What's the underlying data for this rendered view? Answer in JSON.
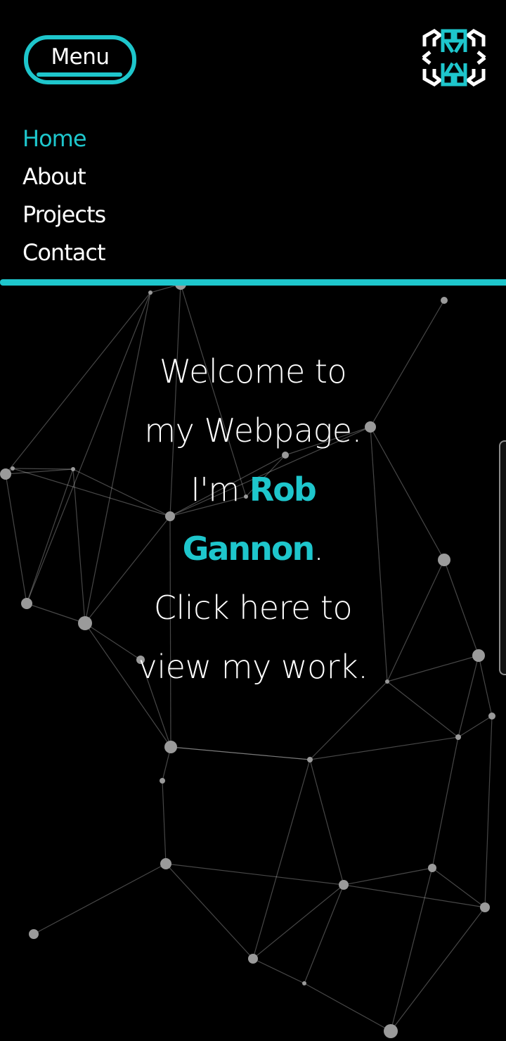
{
  "header": {
    "menu_label": "Menu",
    "logo_icon": "rr-monogram-logo-icon",
    "accent_color": "#1ec6cc"
  },
  "nav": {
    "items": [
      {
        "label": "Home",
        "active": true
      },
      {
        "label": "About",
        "active": false
      },
      {
        "label": "Projects",
        "active": false
      },
      {
        "label": "Contact",
        "active": false
      }
    ]
  },
  "hero": {
    "line1": "Welcome to",
    "line2": "my Webpage.",
    "im": "I'm ",
    "name_first": "Rob",
    "name_last": "Gannon",
    "period": ".",
    "line5": "Click here to",
    "line6": "view my work."
  }
}
